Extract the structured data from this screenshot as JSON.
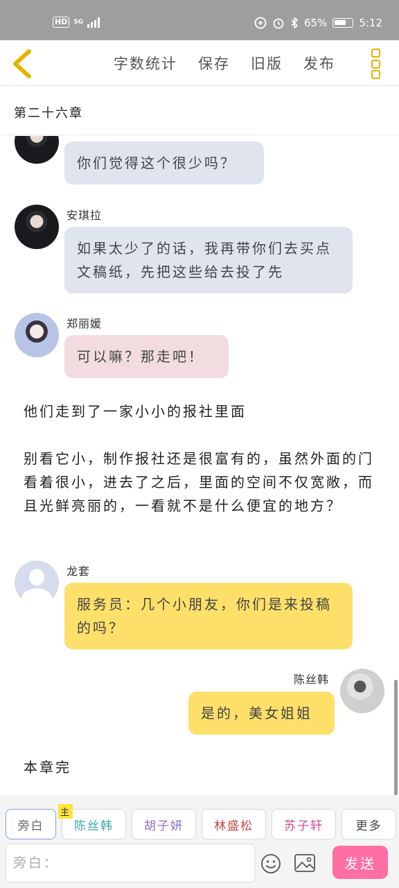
{
  "status_bar": {
    "hd": "HD",
    "network": "5G",
    "battery_pct": "65%",
    "time": "5:12"
  },
  "toolbar": {
    "items": [
      "字数统计",
      "保存",
      "旧版",
      "发布"
    ]
  },
  "chapter": {
    "title": "第二十六章"
  },
  "messages": [
    {
      "speaker": "",
      "text": "你们觉得这个很少吗？"
    },
    {
      "speaker": "安琪拉",
      "text": "如果太少了的话，我再带你们去买点文稿纸，先把这些给去投了先"
    },
    {
      "speaker": "郑丽媛",
      "text": "可以嘛？那走吧！"
    },
    {
      "narration": "他们走到了一家小小的报社里面"
    },
    {
      "narration": "别看它小，制作报社还是很富有的，虽然外面的门看着很小，进去了之后，里面的空间不仅宽敞，而且光鲜亮丽的，一看就不是什么便宜的地方？"
    },
    {
      "speaker": "龙套",
      "text": "服务员：几个小朋友，你们是来投稿的吗？"
    },
    {
      "speaker": "陈丝韩",
      "text": "是的，美女姐姐"
    },
    {
      "narration": "本章完"
    }
  ],
  "characters": {
    "narrator": "旁白",
    "main_tag": "主",
    "list": [
      {
        "name": "陈丝韩",
        "color": "#3aa8a8"
      },
      {
        "name": "胡子妍",
        "color": "#8e6bc4"
      },
      {
        "name": "林盛松",
        "color": "#c04848"
      },
      {
        "name": "苏子轩",
        "color": "#d04898"
      }
    ],
    "more": "更多"
  },
  "input": {
    "placeholder": "旁白："
  },
  "send_label": "发送",
  "colors": {
    "accent": "#e0b400",
    "send": "#ff6fa3",
    "bubble_gray": "#dfe4ee",
    "bubble_pink": "#f2dcdf",
    "bubble_yellow": "#fde06a"
  }
}
